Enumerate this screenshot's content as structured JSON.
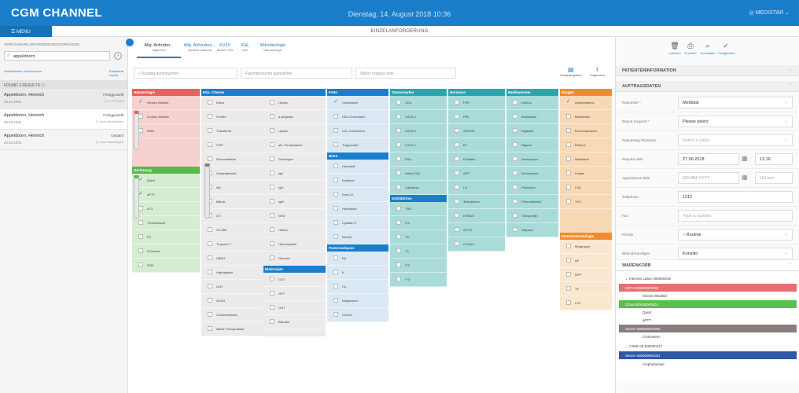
{
  "header": {
    "brand": "CGM CHANNEL",
    "date": "Dienstag, 14. August 2018 10:36",
    "user": "MEDISTAR"
  },
  "menubar": {
    "menu": "MENU",
    "title": "EINZELANFORDERUNG"
  },
  "left": {
    "heading": "VERFÜGBARE ANFORDERUNGSVORGÄNGE",
    "search_value": "appeldoorn",
    "link_reset": "Suchkriterien zurücksetzen",
    "link_extended": "Erweiterte Suche",
    "found": "FOUND 3 RESULTS",
    "results": [
      {
        "name": "Appeldoorn, Heinrich",
        "dob": "02.04.1941",
        "status": "Fertiggestellt",
        "date": "17.07.2018"
      },
      {
        "name": "Appeldoorn, Heinrich",
        "dob": "02.04.1941",
        "status": "Fertiggestellt",
        "date": "noch festzulegen"
      },
      {
        "name": "Appeldoorn, Heinrich",
        "dob": "02.04.1941",
        "status": "Geplant",
        "date": "noch festzulegen"
      }
    ]
  },
  "tabs": [
    {
      "label": "Allg. Anforder...",
      "sub": "Allgemein"
    },
    {
      "label": "Allg. Anforderu...",
      "sub": "anderes Material"
    },
    {
      "label": "KV10",
      "sub": "Muster 10A"
    },
    {
      "label": "K&L",
      "sub": "K&L"
    },
    {
      "label": "Mikrobiologie",
      "sub": "Mikrobiologie"
    }
  ],
  "filters": {
    "catalog": "Katalog durchsuchen",
    "favorites": "Favoritensuche auswählen",
    "request": "Select request sets"
  },
  "tools": {
    "zusatz": "Zusatzangaben",
    "diagnosen": "Diagnosen"
  },
  "grid": {
    "haematologie": {
      "title": "Hämatologie",
      "items": [
        "Kleines Blutbild",
        "Großes Blutbild",
        "Retic"
      ]
    },
    "gerinnung": {
      "title": "Gerinnung",
      "items": [
        "Quick",
        "aPTT",
        "AT3",
        "Thrombinzeit",
        "FII",
        "D-Dimere",
        "FXIII"
      ]
    },
    "klinchemie": {
      "title": "Klin. Chemie",
      "col1": [
        "Eisen",
        "Ferritin",
        "Transferrin",
        "CRP",
        "Rheumafaktor",
        "Gesamteiweiß",
        "Alb",
        "Bilirub.",
        "CK",
        "CK-MB",
        "Troponin T",
        "HBDH",
        "Haptoglobin",
        "LDH",
        "GLDH",
        "Cholinesterase",
        "Alkale Phosphatase"
      ],
      "col2": [
        "Lipase",
        "a-Amylase",
        "Lipase",
        "alk. Phosphatase",
        "Fibrinogen",
        "IgA",
        "IgG",
        "IgM",
        "NH3",
        "HbA1c",
        "Homocystein",
        "Glucose"
      ]
    },
    "elektrolyte": {
      "title": "Elektrolyte",
      "items": [
        "GOT",
        "GPT",
        "GGT",
        "Bilirubin"
      ]
    },
    "fette": {
      "title": "Fette",
      "items": [
        "Cholesterin",
        "HDL-Cholesterin",
        "LDL-Cholesterin",
        "Triglyceride"
      ]
    },
    "niere": {
      "title": "Niere",
      "items": [
        "Harnstoff",
        "Kreatinin",
        "Krea-CL",
        "Harnsäure",
        "Cystatin C",
        "Eiweiß"
      ]
    },
    "pankreas": {
      "title": "Pankreaslipase",
      "items": [
        "Na",
        "K",
        "Ca",
        "Magnesium",
        "Chlorid"
      ]
    },
    "tumormarker": {
      "title": "Tumormarker",
      "items": [
        "CEA",
        "CA15-3",
        "CA19-9",
        "CA72-4",
        "PSA",
        "freies PSA",
        "Calcitonin"
      ]
    },
    "schilddruese": {
      "title": "Schilddrüse",
      "items": [
        "TSH",
        "fT4",
        "T3",
        "T4",
        "fT3",
        "rT3"
      ]
    },
    "hormone": {
      "title": "Hormone",
      "items": [
        "FSH",
        "PRL",
        "SDHOS",
        "E2",
        "Prolaktin",
        "AFP",
        "LH",
        "Testosteron",
        "DHEAS",
        "ACTH",
        "Cortisol"
      ]
    },
    "medikamente": {
      "title": "Medikamente",
      "items": [
        "Lithium",
        "Amiodaron",
        "Digitoxin",
        "Digoxin",
        "Vancomycin",
        "Gentamycin",
        "Phenytoin",
        "Phenobarbital",
        "Theophyllin",
        "Valproat"
      ]
    },
    "drogen": {
      "title": "Drogen",
      "items": [
        "Amphetamine",
        "Barbiturate",
        "Benzodiazepine",
        "Ethanol",
        "Methadon",
        "Kokain",
        "LSD",
        "THC"
      ]
    },
    "immunhaem": {
      "title": "Immunhämatologie",
      "items": [
        "Blutgruppe",
        "AK",
        "DPP",
        "TK",
        "LTO"
      ]
    }
  },
  "patient": {
    "title": "PATIENTENINFORMATION"
  },
  "auftrag": {
    "title": "AUFTRAGSDATEN",
    "fields": [
      {
        "label": "Requester *",
        "value": "Medistar"
      },
      {
        "label": "Report recipient *",
        "value": "Please select"
      },
      {
        "label": "Requesting Physician",
        "value": "Select a value"
      },
      {
        "label": "Request date",
        "value": "27.06.2018",
        "time": "12:16"
      },
      {
        "label": "Appointment date",
        "value": "DD.MM.YYYY",
        "time": "HH:mm"
      },
      {
        "label": "Telephone",
        "value": "1212"
      },
      {
        "label": "Fax",
        "value": "Type a number"
      },
      {
        "label": "Priority",
        "value": "Routine"
      },
      {
        "label": "Befund/Sonstiges",
        "value": "Konsilio"
      }
    ]
  },
  "cart": {
    "title": "WARENKORB",
    "lab1": "Internes Labor 000000018",
    "lab2": "CSMLAB 000000127",
    "rows": [
      {
        "text": "EDTA 000000000001",
        "bg": "#e86f6f"
      },
      {
        "text": "Kleines Blutbild",
        "bg": "#fff"
      },
      {
        "text": "Citrat 000000000001",
        "bg": "#5bbf4e"
      },
      {
        "text": "Quick",
        "bg": "#fff"
      },
      {
        "text": "aPTT",
        "bg": "#fff"
      },
      {
        "text": "Serum 000000001006",
        "bg": "#8a7d7d"
      },
      {
        "text": "Cholesterin",
        "bg": "#fff"
      },
      {
        "text": "Serum 000000001001",
        "bg": "#2e57a8"
      },
      {
        "text": "Amphetamine",
        "bg": "#fff"
      }
    ]
  }
}
